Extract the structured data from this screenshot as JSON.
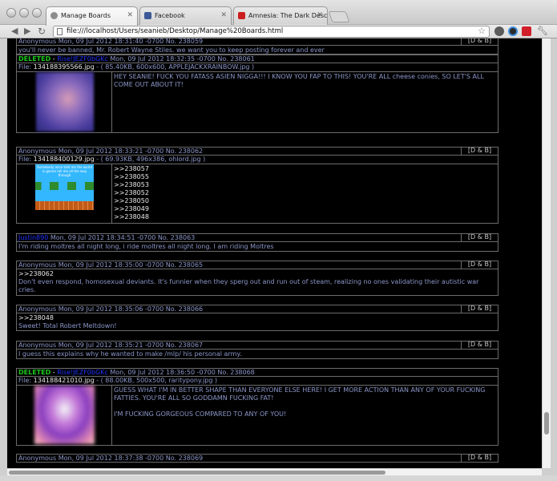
{
  "browser": {
    "tabs": [
      {
        "title": "Manage Boards",
        "color": "#7a7a7a"
      },
      {
        "title": "Facebook",
        "color": "#3b5998"
      },
      {
        "title": "Amnesia: The Dark Descent",
        "color": "#cc1d1d"
      }
    ],
    "url": "file:///localhost/Users/seanieb/Desktop/Manage%20Boards.html"
  },
  "db_label": "[D & B]",
  "posts": [
    {
      "name": "Anonymous",
      "date": "Mon, 09 Jul 2012 18:31:40 -0700",
      "no": "No. 238059",
      "message": "you'll never be banned, Mr. Robert Wayne Stiles. we want you to keep posting forever and ever"
    },
    {
      "deleted": "DELETED",
      "separator": " - ",
      "name": "Rise!JEZF0bGKc",
      "date": "Mon, 09 Jul 2012 18:32:35 -0700",
      "no": "No. 238061",
      "file_label": "File:",
      "file_name": "134188395566.jpg",
      "file_meta": "- ( 85.40KB, 600x600, APPLEJACKXRAINBOW.jpg )",
      "message": "HEY SEANIE! FUCK YOU FATASS ASIEN NIGGA!!! I KNOW YOU FAP TO THIS! YOU'RE ALL cheese conies, SO LET'S ALL COME OUT ABOUT IT!"
    },
    {
      "name": "Anonymous",
      "date": "Mon, 09 Jul 2012 18:33:21 -0700",
      "no": "No. 238062",
      "file_label": "File:",
      "file_name": "134188400129.jpg",
      "file_meta": "- ( 69.93KB, 496x386, ohlord.jpg )",
      "thumb_caption": "Somebody once told me the world is gonna roll me all the way through",
      "quotes": [
        ">>238057",
        ">>238055",
        ">>238053",
        ">>238052",
        ">>238050",
        ">>238049",
        ">>238048"
      ]
    },
    {
      "name": "Justin890",
      "date": "Mon, 09 Jul 2012 18:34:51 -0700",
      "no": "No. 238063",
      "message": "I'm riding moltres all night long, i ride moltres all night long. I am riding Moltres"
    },
    {
      "name": "Anonymous",
      "date": "Mon, 09 Jul 2012 18:35:00 -0700",
      "no": "No. 238065",
      "quote": ">>238062",
      "message": "Don't even respond, homosexual deviants. It's funnier when they sperg out and run out of steam, realizing no ones validating their autistic war cries."
    },
    {
      "name": "Anonymous",
      "date": "Mon, 09 Jul 2012 18:35:06 -0700",
      "no": "No. 238066",
      "quote": ">>238048",
      "message": "Sweet! Total Robert Meltdown!"
    },
    {
      "name": "Anonymous",
      "date": "Mon, 09 Jul 2012 18:35:21 -0700",
      "no": "No. 238067",
      "message": "I guess this explains why he wanted to make /mlp/ his personal army."
    },
    {
      "deleted": "DELETED",
      "separator": " - ",
      "name": "Rise!JEZF0bGKc",
      "date": "Mon, 09 Jul 2012 18:36:50 -0700",
      "no": "No. 238068",
      "file_label": "File:",
      "file_name": "134188421010.jpg",
      "file_meta": "- ( 88.00KB, 500x500, raritypony.jpg )",
      "message": "GUESS WHAT I'M IN BETTER SHAPE THAN EVERYONE ELSE HERE! I GET MORE ACTION THAN ANY OF YOUR FUCKING FATTIES. YOU'RE ALL SO GODDAMN FUCKING FAT!\n\nI'M FUCKING GORGEOUS COMPARED TO ANY OF YOU!"
    },
    {
      "name": "Anonymous",
      "date": "Mon, 09 Jul 2012 18:37:38 -0700",
      "no": "No. 238069"
    }
  ]
}
